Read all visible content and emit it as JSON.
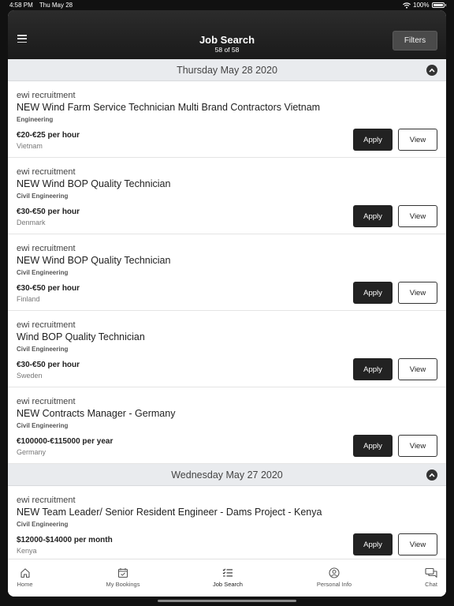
{
  "status": {
    "time": "4:58 PM",
    "date": "Thu May 28",
    "battery": "100%"
  },
  "header": {
    "title": "Job Search",
    "subtitle": "58 of 58",
    "filters_label": "Filters"
  },
  "sections": [
    {
      "date": "Thursday May 28 2020",
      "jobs": [
        {
          "company": "ewi recruitment",
          "title": "NEW Wind Farm Service Technician Multi Brand Contractors Vietnam",
          "category": "Engineering",
          "pay": "€20-€25 per hour",
          "location": "Vietnam",
          "apply_label": "Apply",
          "view_label": "View"
        },
        {
          "company": "ewi recruitment",
          "title": "NEW Wind BOP Quality Technician",
          "category": "Civil Engineering",
          "pay": "€30-€50 per hour",
          "location": "Denmark",
          "apply_label": "Apply",
          "view_label": "View"
        },
        {
          "company": "ewi recruitment",
          "title": "NEW Wind BOP Quality Technician",
          "category": "Civil Engineering",
          "pay": "€30-€50 per hour",
          "location": "Finland",
          "apply_label": "Apply",
          "view_label": "View"
        },
        {
          "company": "ewi recruitment",
          "title": "Wind BOP Quality Technician",
          "category": "Civil Engineering",
          "pay": "€30-€50 per hour",
          "location": "Sweden",
          "apply_label": "Apply",
          "view_label": "View"
        },
        {
          "company": "ewi recruitment",
          "title": "NEW Contracts Manager - Germany",
          "category": "Civil Engineering",
          "pay": "€100000-€115000 per year",
          "location": "Germany",
          "apply_label": "Apply",
          "view_label": "View"
        }
      ]
    },
    {
      "date": "Wednesday May 27 2020",
      "jobs": [
        {
          "company": "ewi recruitment",
          "title": "NEW Team Leader/ Senior Resident Engineer - Dams Project - Kenya",
          "category": "Civil Engineering",
          "pay": "$12000-$14000 per month",
          "location": "Kenya",
          "apply_label": "Apply",
          "view_label": "View"
        }
      ]
    }
  ],
  "tabs": [
    {
      "label": "Home",
      "icon": "home-icon"
    },
    {
      "label": "My Bookings",
      "icon": "calendar-check-icon"
    },
    {
      "label": "Job Search",
      "icon": "checklist-icon",
      "active": true
    },
    {
      "label": "Personal Info",
      "icon": "user-circle-icon"
    },
    {
      "label": "Chat",
      "icon": "chat-bubbles-icon"
    }
  ],
  "colors": {
    "header_bg": "#1f1f1f",
    "apply_bg": "#222222",
    "section_bg": "#e9ebee"
  }
}
